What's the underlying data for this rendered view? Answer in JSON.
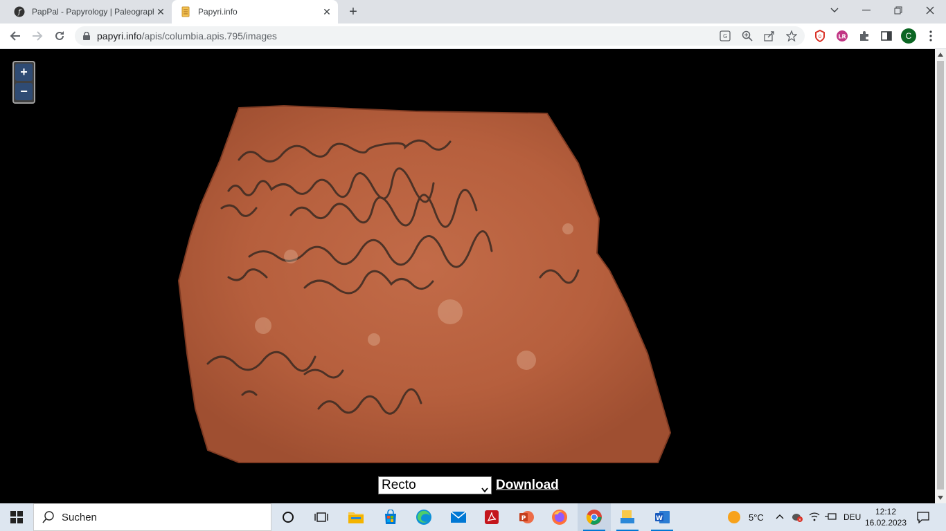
{
  "browser": {
    "tabs": [
      {
        "title": "PapPal - Papyrology | Paleograph",
        "active": false,
        "icon": "pappal-favicon"
      },
      {
        "title": "Papyri.info",
        "active": true,
        "icon": "scroll-favicon"
      }
    ],
    "url_host": "papyri.info",
    "url_path": "/apis/columbia.apis.795/images",
    "profile_initial": "C"
  },
  "viewer": {
    "zoom_in_label": "+",
    "zoom_out_label": "−",
    "side_select_value": "Recto",
    "download_label": "Download"
  },
  "taskbar": {
    "search_placeholder": "Suchen",
    "weather_temp": "5°C",
    "language": "DEU",
    "time": "12:12",
    "date": "16.02.2023"
  },
  "colors": {
    "sherd": "#b8623f",
    "ink": "#3a2a22",
    "zoom_button": "#2f4b73"
  }
}
